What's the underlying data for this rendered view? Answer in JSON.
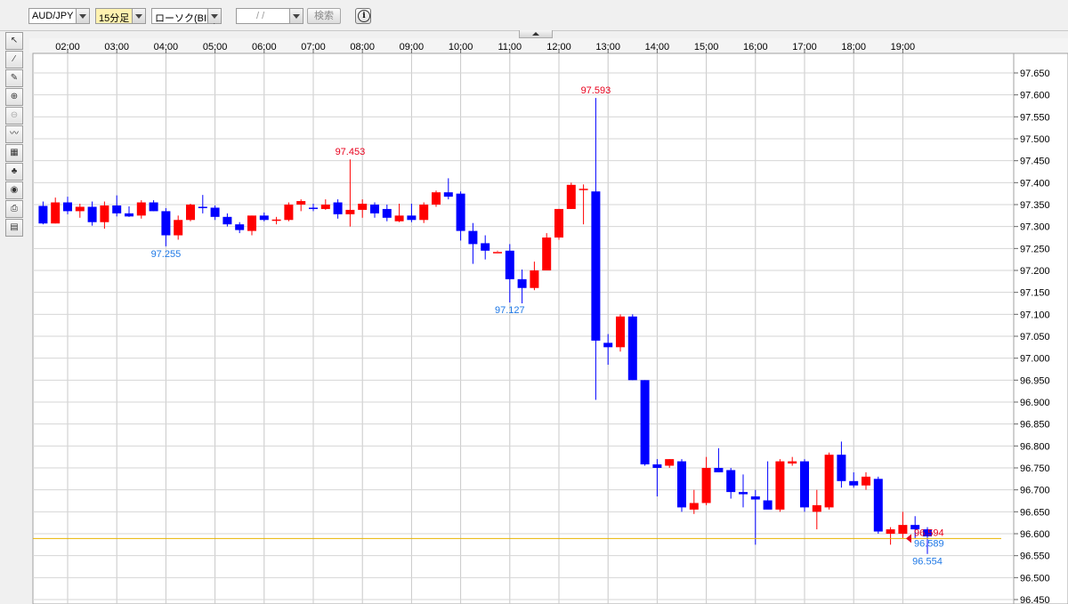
{
  "toolbar": {
    "symbol": "AUD/JPY",
    "timeframe": "15分足",
    "chart_style": "ローソク(BID)",
    "date_input": "  /  /",
    "search_label": "検索",
    "info_label": "i"
  },
  "colors": {
    "up": "#ff0000",
    "down": "#0000ff",
    "current_line": "#e8b400",
    "high_label": "#e8001c",
    "low_label": "#1e78e6"
  },
  "chart_data": {
    "type": "candlestick",
    "title": "",
    "instrument": "AUD/JPY",
    "interval": "15分足",
    "price_type": "BID",
    "x_ticks": [
      "02:00",
      "03:00",
      "04:00",
      "05:00",
      "06:00",
      "07:00",
      "08:00",
      "09:00",
      "10:00",
      "11:00",
      "12:00",
      "13:00",
      "14:00",
      "15:00",
      "16:00",
      "17:00",
      "18:00",
      "19:00"
    ],
    "y_ticks": [
      "97.650",
      "97.600",
      "97.550",
      "97.500",
      "97.450",
      "97.400",
      "97.350",
      "97.300",
      "97.250",
      "97.200",
      "97.150",
      "97.100",
      "97.050",
      "97.000",
      "96.950",
      "96.900",
      "96.850",
      "96.800",
      "96.750",
      "96.700",
      "96.650",
      "96.600",
      "96.550",
      "96.500",
      "96.450"
    ],
    "ylim": [
      96.45,
      97.67
    ],
    "grid": true,
    "start_time": "01:30",
    "candles": [
      [
        97.347,
        97.357,
        97.305,
        97.307
      ],
      [
        97.307,
        97.366,
        97.307,
        97.355
      ],
      [
        97.355,
        97.368,
        97.328,
        97.335
      ],
      [
        97.335,
        97.352,
        97.32,
        97.345
      ],
      [
        97.345,
        97.357,
        97.302,
        97.31
      ],
      [
        97.31,
        97.357,
        97.295,
        97.348
      ],
      [
        97.348,
        97.371,
        97.323,
        97.33
      ],
      [
        97.33,
        97.346,
        97.322,
        97.323
      ],
      [
        97.325,
        97.36,
        97.318,
        97.355
      ],
      [
        97.355,
        97.36,
        97.335,
        97.335
      ],
      [
        97.335,
        97.342,
        97.255,
        97.28
      ],
      [
        97.28,
        97.325,
        97.27,
        97.315
      ],
      [
        97.315,
        97.352,
        97.312,
        97.35
      ],
      [
        97.345,
        97.372,
        97.33,
        97.343
      ],
      [
        97.343,
        97.348,
        97.315,
        97.322
      ],
      [
        97.322,
        97.33,
        97.3,
        97.305
      ],
      [
        97.305,
        97.31,
        97.285,
        97.292
      ],
      [
        97.29,
        97.325,
        97.28,
        97.325
      ],
      [
        97.325,
        97.332,
        97.312,
        97.315
      ],
      [
        97.313,
        97.322,
        97.305,
        97.316
      ],
      [
        97.315,
        97.355,
        97.312,
        97.35
      ],
      [
        97.35,
        97.362,
        97.335,
        97.358
      ],
      [
        97.343,
        97.352,
        97.335,
        97.34
      ],
      [
        97.34,
        97.362,
        97.338,
        97.35
      ],
      [
        97.355,
        97.362,
        97.318,
        97.328
      ],
      [
        97.328,
        97.453,
        97.3,
        97.338
      ],
      [
        97.338,
        97.362,
        97.32,
        97.352
      ],
      [
        97.35,
        97.355,
        97.32,
        97.33
      ],
      [
        97.34,
        97.35,
        97.312,
        97.32
      ],
      [
        97.312,
        97.352,
        97.31,
        97.325
      ],
      [
        97.325,
        97.352,
        97.31,
        97.315
      ],
      [
        97.315,
        97.355,
        97.308,
        97.35
      ],
      [
        97.35,
        97.382,
        97.345,
        97.378
      ],
      [
        97.378,
        97.41,
        97.362,
        97.368
      ],
      [
        97.375,
        97.38,
        97.268,
        97.29
      ],
      [
        97.29,
        97.308,
        97.215,
        97.26
      ],
      [
        97.262,
        97.28,
        97.225,
        97.245
      ],
      [
        97.242,
        97.245,
        97.243,
        97.242
      ],
      [
        97.245,
        97.26,
        97.127,
        97.18
      ],
      [
        97.18,
        97.202,
        97.125,
        97.16
      ],
      [
        97.16,
        97.22,
        97.155,
        97.2
      ],
      [
        97.2,
        97.285,
        97.2,
        97.275
      ],
      [
        97.275,
        97.34,
        97.27,
        97.34
      ],
      [
        97.34,
        97.4,
        97.34,
        97.395
      ],
      [
        97.385,
        97.396,
        97.305,
        97.386
      ],
      [
        97.38,
        97.593,
        96.905,
        97.04
      ],
      [
        97.035,
        97.055,
        96.985,
        97.025
      ],
      [
        97.025,
        97.1,
        97.015,
        97.095
      ],
      [
        97.095,
        97.1,
        96.95,
        96.95
      ],
      [
        96.95,
        96.95,
        96.755,
        96.758
      ],
      [
        96.758,
        96.77,
        96.685,
        96.75
      ],
      [
        96.755,
        96.77,
        96.75,
        96.77
      ],
      [
        96.765,
        96.77,
        96.65,
        96.66
      ],
      [
        96.655,
        96.7,
        96.645,
        96.67
      ],
      [
        96.67,
        96.775,
        96.665,
        96.75
      ],
      [
        96.75,
        96.795,
        96.74,
        96.74
      ],
      [
        96.745,
        96.75,
        96.68,
        96.695
      ],
      [
        96.695,
        96.735,
        96.66,
        96.69
      ],
      [
        96.685,
        96.7,
        96.575,
        96.678
      ],
      [
        96.676,
        96.765,
        96.675,
        96.655
      ],
      [
        96.655,
        96.77,
        96.65,
        96.765
      ],
      [
        96.76,
        96.775,
        96.755,
        96.765
      ],
      [
        96.765,
        96.77,
        96.65,
        96.66
      ],
      [
        96.65,
        96.7,
        96.61,
        96.665
      ],
      [
        96.66,
        96.785,
        96.655,
        96.78
      ],
      [
        96.78,
        96.81,
        96.705,
        96.72
      ],
      [
        96.72,
        96.74,
        96.705,
        96.71
      ],
      [
        96.71,
        96.74,
        96.7,
        96.73
      ],
      [
        96.725,
        96.73,
        96.6,
        96.605
      ],
      [
        96.6,
        96.615,
        96.575,
        96.61
      ],
      [
        96.6,
        96.65,
        96.59,
        96.62
      ],
      [
        96.62,
        96.64,
        96.59,
        96.61
      ],
      [
        96.61,
        96.615,
        96.554,
        96.594
      ]
    ],
    "annotations": [
      {
        "text": "97.593",
        "kind": "high",
        "price": 97.593
      },
      {
        "text": "97.453",
        "kind": "high",
        "price": 97.453
      },
      {
        "text": "97.255",
        "kind": "low",
        "price": 97.255
      },
      {
        "text": "97.127",
        "kind": "low",
        "price": 97.127
      },
      {
        "text": "96.554",
        "kind": "low",
        "price": 96.554
      }
    ],
    "current_price": {
      "ask_text": "96.594",
      "bid_text": "96.589",
      "value": 96.589
    }
  }
}
